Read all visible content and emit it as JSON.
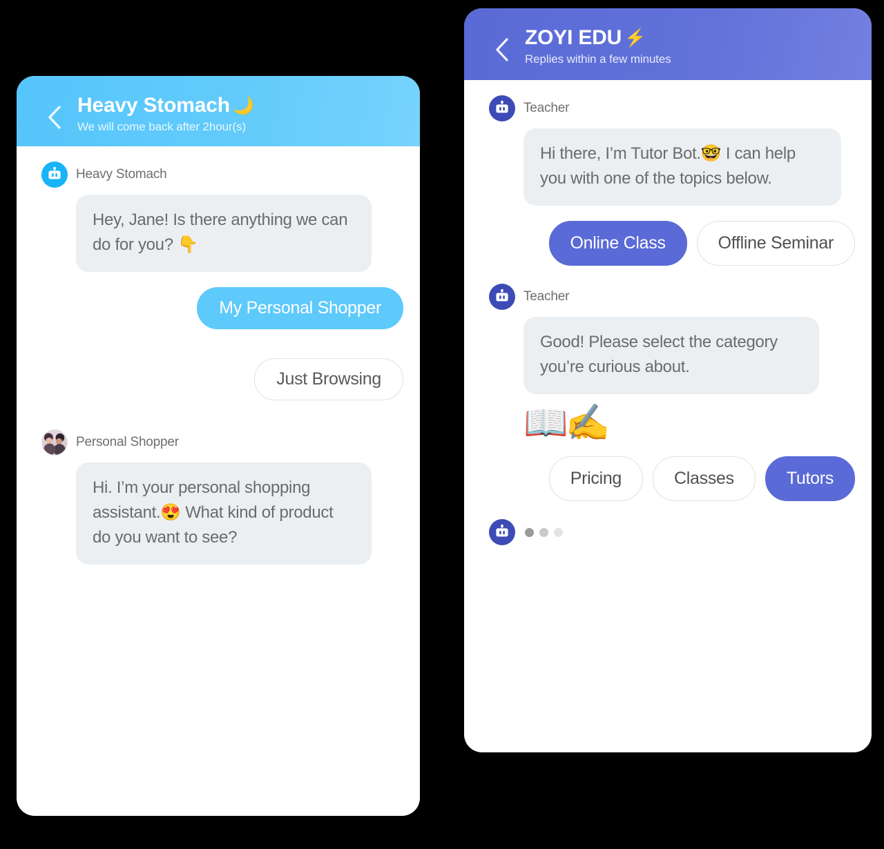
{
  "shopper_phone": {
    "header": {
      "back_icon": "chevron-left-icon",
      "title": "Heavy Stomach",
      "title_emoji": "🌙",
      "subtitle": "We will come back after 2hour(s)",
      "bg_color": "#5cc8fa"
    },
    "messages": [
      {
        "sender": "Heavy Stomach",
        "avatar": "robot-icon",
        "text": "Hey, Jane! Is there anything we can do for you? 👇"
      }
    ],
    "replies": [
      {
        "label": "My Personal Shopper",
        "style": "filled"
      },
      {
        "label": "Just Browsing",
        "style": "outline"
      }
    ],
    "second_message": {
      "sender": "Personal Shopper",
      "avatar": "photo-avatar",
      "text": "Hi. I’m your personal shopping assistant.😍 What kind of product do you want to see?"
    }
  },
  "edu_phone": {
    "header": {
      "back_icon": "chevron-left-icon",
      "title": "ZOYI EDU",
      "title_emoji": "⚡",
      "subtitle": "Replies within a few minutes",
      "bg_color": "#5b6bd6"
    },
    "messages": [
      {
        "sender": "Teacher",
        "avatar": "robot-icon",
        "text": "Hi there, I’m Tutor Bot.🤓 I can help you with one of the topics below."
      },
      {
        "sender": "Teacher",
        "avatar": "robot-icon",
        "text": "Good! Please select the category you’re curious about.",
        "emoji_attachment": "📖✍️"
      }
    ],
    "topic_buttons": [
      {
        "label": "Online Class",
        "style": "filled"
      },
      {
        "label": "Offline Seminar",
        "style": "outline"
      }
    ],
    "category_buttons": [
      {
        "label": "Pricing",
        "style": "outline"
      },
      {
        "label": "Classes",
        "style": "outline"
      },
      {
        "label": "Tutors",
        "style": "filled"
      }
    ],
    "typing_indicator": {
      "avatar": "robot-icon",
      "dots": 3
    }
  },
  "colors": {
    "shopper_accent": "#5cc8fa",
    "edu_accent": "#5b6bd6",
    "bubble_bg": "#ebeff2",
    "bubble_text": "#6b6b6b",
    "page_bg": "#000000"
  }
}
